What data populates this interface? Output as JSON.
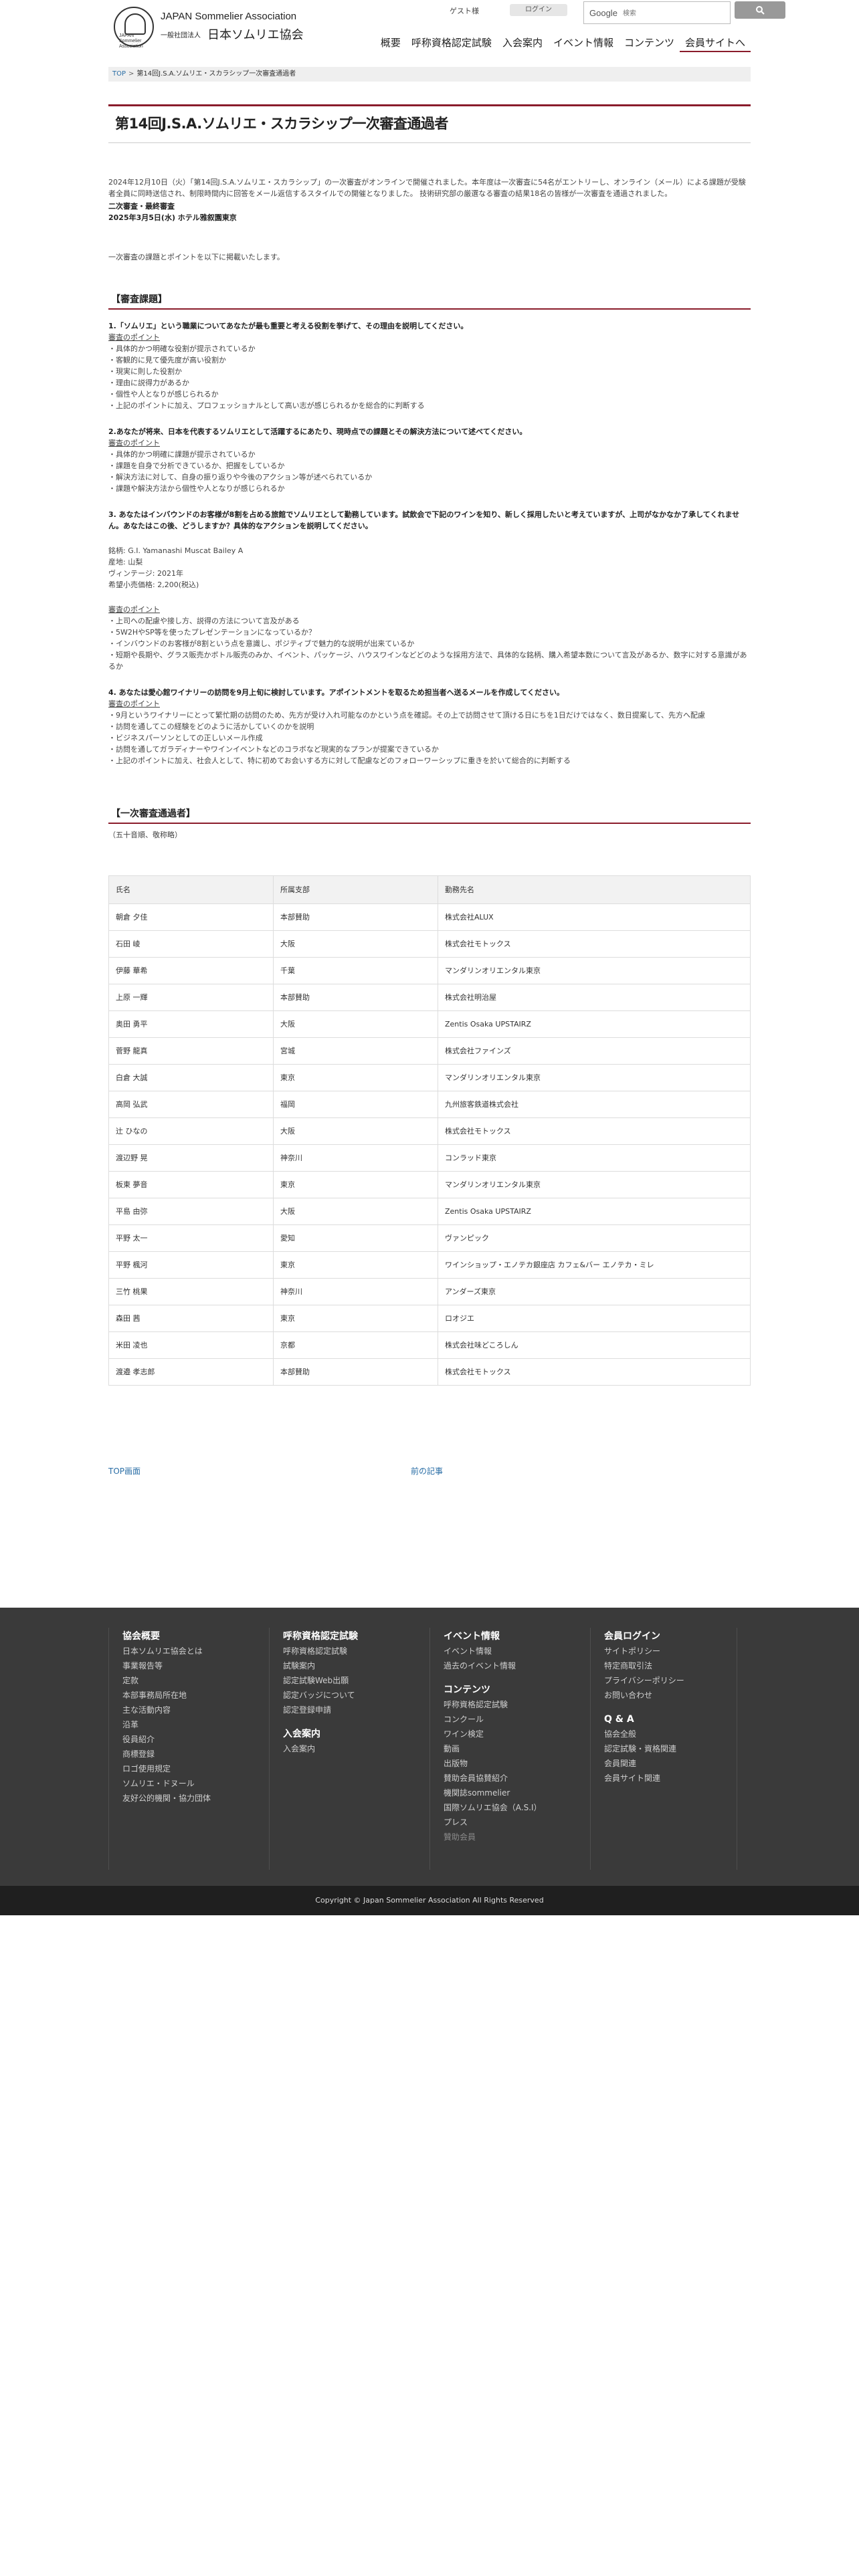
{
  "header": {
    "logo_en": "JAPAN Sommelier Association",
    "logo_jp_small": "一般社団法人",
    "logo_jp": "日本ソムリエ協会",
    "logo_emblem_text": "JAPAN Sommelier Association",
    "guest_label": "ゲスト様",
    "login_label": "ログイン",
    "search_engine_label": "Google",
    "search_placeholder": "検索",
    "search_button_icon": "search-icon",
    "nav": [
      "概要",
      "呼称資格認定試験",
      "入会案内",
      "イベント情報",
      "コンテンツ",
      "会員サイトへ"
    ]
  },
  "breadcrumb": {
    "top": "TOP",
    "separator": ">",
    "current": "第14回J.S.A.ソムリエ・スカラシップ一次審査通過者"
  },
  "page_title": "第14回J.S.A.ソムリエ・スカラシップ一次審査通過者",
  "intro": {
    "paragraph": "2024年12月10日（火）「第14回J.S.A.ソムリエ・スカラシップ」の一次審査がオンラインで開催されました。本年度は一次審査に54名がエントリーし、オンライン（メール）による課題が受験者全員に同時送信され、制限時間内に回答をメール返信するスタイルでの開催となりました。 技術研究部の厳選なる審査の結果18名の皆様が一次審査を通過されました。",
    "second_title": "二次審査・最終審査",
    "second_date": "2025年3月5日(水) ホテル雅叙園東京",
    "notice": "一次審査の課題とポイントを以下に掲載いたします。"
  },
  "sections": {
    "tasks_heading": "【審査課題】",
    "passers_heading": "【一次審査通過者】",
    "passers_note": "（五十音順、敬称略）"
  },
  "questions": [
    {
      "title": "1.「ソムリエ」という職業についてあなたが最も重要と考える役割を挙げて、その理由を説明してください。",
      "point_label": "審査のポイント",
      "points": [
        "・具体的かつ明確な役割が提示されているか",
        "・客観的に見て優先度が高い役割か",
        "・現実に則した役割か",
        "・理由に説得力があるか",
        "・個性や人となりが感じられるか",
        "・上記のポイントに加え、プロフェッショナルとして高い志が感じられるかを総合的に判断する"
      ]
    },
    {
      "title": "2.あなたが将来、日本を代表するソムリエとして活躍するにあたり、現時点での課題とその解決方法について述べてください。",
      "point_label": "審査のポイント",
      "points": [
        "・具体的かつ明確に課題が提示されているか",
        "・課題を自身で分析できているか、把握をしているか",
        "・解決方法に対して、自身の振り返りや今後のアクション等が述べられているか",
        "・課題や解決方法から個性や人となりが感じられるか"
      ]
    },
    {
      "title": "3. あなたはインバウンドのお客様が8割を占める旅館でソムリエとして勤務しています。試飲会で下記のワインを知り、新しく採用したいと考えていますが、上司がなかなか了承してくれません。あなたはこの後、どうしますか？具体的なアクションを説明してください。",
      "wine": [
        "銘柄: G.I. Yamanashi Muscat Bailey A",
        "産地: 山梨",
        "ヴィンテージ: 2021年",
        "希望小売価格: 2,200(税込)"
      ],
      "point_label": "審査のポイント",
      "points": [
        "・上司への配慮や接し方、説得の方法について言及がある",
        "・5W2HやSP等を使ったプレゼンテーションになっているか？",
        "・インバウンドのお客様が8割という点を意識し、ポジティブで魅力的な説明が出来ているか",
        "・短期や長期や、グラス販売かボトル販売のみか、イベント、パッケージ、ハウスワインなどどのような採用方法で、具体的な銘柄、購入希望本数について言及があるか、数字に対する意識があるか"
      ]
    },
    {
      "title": "4. あなたは愛心館ワイナリーの訪問を9月上旬に検討しています。アポイントメントを取るため担当者へ送るメールを作成してください。",
      "point_label": "審査のポイント",
      "points": [
        "・9月というワイナリーにとって繁忙期の訪問のため、先方が受け入れ可能なのかという点を確認。その上で訪問させて頂ける日にちを1日だけではなく、数日提案して、先方へ配慮",
        "・訪問を通してこの経験をどのように活かしていくのかを説明",
        "・ビジネスパーソンとしての正しいメール作成",
        "・訪問を通してガラディナーやワインイベントなどのコラボなど現実的なプランが提案できているか",
        "・上記のポイントに加え、社会人として、特に初めてお会いする方に対して配慮などのフォローワーシップに重きを於いて総合的に判断する"
      ]
    }
  ],
  "table": {
    "headers": [
      "氏名",
      "所属支部",
      "勤務先名"
    ],
    "rows": [
      [
        "朝倉 夕佳",
        "本部賛助",
        "株式会社ALUX"
      ],
      [
        "石田 崚",
        "大阪",
        "株式会社モトックス"
      ],
      [
        "伊藤 華希",
        "千葉",
        "マンダリンオリエンタル東京"
      ],
      [
        "上原 一輝",
        "本部賛助",
        "株式会社明治屋"
      ],
      [
        "奥田 勇平",
        "大阪",
        "Zentis Osaka UPSTAIRZ"
      ],
      [
        "菅野 龍真",
        "宮城",
        "株式会社ファインズ"
      ],
      [
        "白倉 大誠",
        "東京",
        "マンダリンオリエンタル東京"
      ],
      [
        "高岡 弘武",
        "福岡",
        "九州旅客鉄道株式会社"
      ],
      [
        "辻 ひなの",
        "大阪",
        "株式会社モトックス"
      ],
      [
        "渡辺野 晃",
        "神奈川",
        "コンラッド東京"
      ],
      [
        "板東 夢音",
        "東京",
        "マンダリンオリエンタル東京"
      ],
      [
        "平島 由弥",
        "大阪",
        "Zentis Osaka UPSTAIRZ"
      ],
      [
        "平野 太一",
        "愛知",
        "ヴァンピック"
      ],
      [
        "平野 楓河",
        "東京",
        "ワインショップ・エノテカ銀座店 カフェ&バー エノテカ・ミレ"
      ],
      [
        "三竹 桃果",
        "神奈川",
        "アンダーズ東京"
      ],
      [
        "森田 茜",
        "東京",
        "ロオジエ"
      ],
      [
        "米田 凌也",
        "京都",
        "株式会社味どころしん"
      ],
      [
        "渡邉 孝志郎",
        "本部賛助",
        "株式会社モトックス"
      ]
    ]
  },
  "pager": {
    "top": "TOP画面",
    "prev": "前の記事"
  },
  "footer": {
    "columns": [
      {
        "head": "協会概要",
        "items": [
          "日本ソムリエ協会とは",
          "事業報告等",
          "定款",
          "本部事務局所在地",
          "主な活動内容",
          "沿革",
          "役員紹介",
          "商標登録",
          "ロゴ使用規定",
          "ソムリエ・ドヌール",
          "友好公的機関・協力団体"
        ]
      },
      {
        "head": "呼称資格認定試験",
        "items": [
          "呼称資格認定試験",
          "試験案内",
          "認定試験Web出願",
          "認定バッジについて",
          "認定登録申請"
        ],
        "head2": "入会案内",
        "items2": [
          "入会案内"
        ]
      },
      {
        "head": "イベント情報",
        "items": [
          "イベント情報",
          "過去のイベント情報"
        ],
        "head2": "コンテンツ",
        "items2": [
          "呼称資格認定試験",
          "コンクール",
          "ワイン検定",
          "動画",
          "出版物",
          "賛助会員協賛紹介",
          "機関誌sommelier",
          "国際ソムリエ協会（A.S.I）",
          "プレス",
          "贊助会員"
        ]
      },
      {
        "head": "会員ログイン",
        "items": [
          "サイトポリシー",
          "特定商取引法",
          "プライバシーポリシー",
          "お問い合わせ"
        ],
        "head2": "Q & A",
        "items2": [
          "協会全般",
          "認定試験・資格関連",
          "会員関連",
          "会員サイト関連"
        ]
      }
    ],
    "copyright": "Copyright © Japan Sommelier Association All Rights Reserved"
  }
}
